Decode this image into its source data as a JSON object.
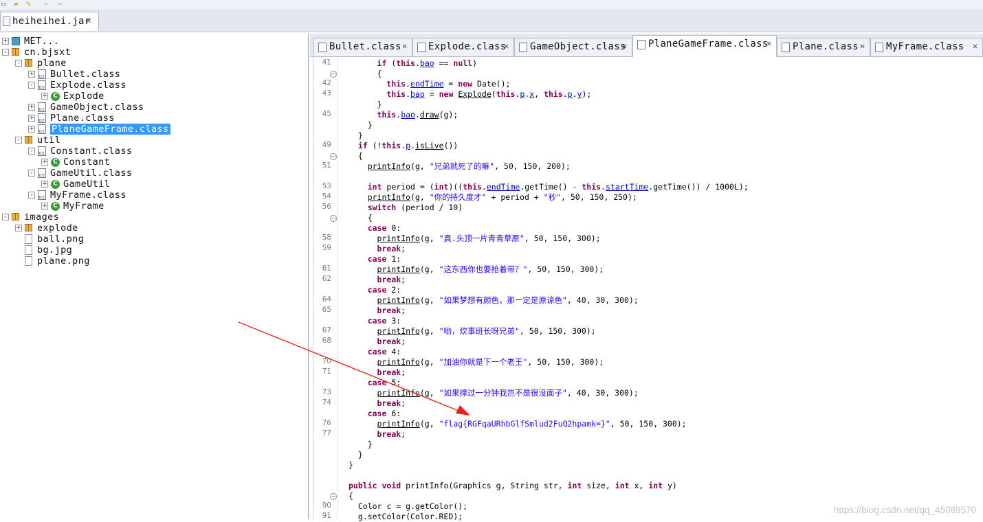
{
  "file_tab": {
    "label": "heiheihei.jar"
  },
  "tree": [
    {
      "label": "MET...",
      "kind": "meta",
      "indent": 0,
      "expander": "+"
    },
    {
      "label": "cn.bjsxt",
      "kind": "package",
      "indent": 0,
      "expander": "-"
    },
    {
      "label": "plane",
      "kind": "package",
      "indent": 1,
      "expander": "-"
    },
    {
      "label": "Bullet.class",
      "kind": "class",
      "indent": 2,
      "expander": "+"
    },
    {
      "label": "Explode.class",
      "kind": "class",
      "indent": 2,
      "expander": "-"
    },
    {
      "label": "Explode",
      "kind": "type",
      "indent": 3,
      "expander": "+"
    },
    {
      "label": "GameObject.class",
      "kind": "class",
      "indent": 2,
      "expander": "+"
    },
    {
      "label": "Plane.class",
      "kind": "class",
      "indent": 2,
      "expander": "+"
    },
    {
      "label": "PlaneGameFrame.class",
      "kind": "class",
      "indent": 2,
      "expander": "+",
      "selected": true
    },
    {
      "label": "util",
      "kind": "package",
      "indent": 1,
      "expander": "-"
    },
    {
      "label": "Constant.class",
      "kind": "class",
      "indent": 2,
      "expander": "-"
    },
    {
      "label": "Constant",
      "kind": "type",
      "indent": 3,
      "expander": "+"
    },
    {
      "label": "GameUtil.class",
      "kind": "class",
      "indent": 2,
      "expander": "-"
    },
    {
      "label": "GameUtil",
      "kind": "type",
      "indent": 3,
      "expander": "+"
    },
    {
      "label": "MyFrame.class",
      "kind": "class",
      "indent": 2,
      "expander": "-"
    },
    {
      "label": "MyFrame",
      "kind": "type",
      "indent": 3,
      "expander": "+"
    },
    {
      "label": "images",
      "kind": "package",
      "indent": 0,
      "expander": "-"
    },
    {
      "label": "explode",
      "kind": "package",
      "indent": 1,
      "expander": "+"
    },
    {
      "label": "ball.png",
      "kind": "file",
      "indent": 1,
      "expander": ""
    },
    {
      "label": "bg.jpg",
      "kind": "file",
      "indent": 1,
      "expander": ""
    },
    {
      "label": "plane.png",
      "kind": "file",
      "indent": 1,
      "expander": ""
    }
  ],
  "editor_tabs": [
    {
      "label": "Bullet.class",
      "active": false
    },
    {
      "label": "Explode.class",
      "active": false
    },
    {
      "label": "GameObject.class",
      "active": false
    },
    {
      "label": "PlaneGameFrame.class",
      "active": true
    },
    {
      "label": "Plane.class",
      "active": false
    },
    {
      "label": "MyFrame.class",
      "active": false
    }
  ],
  "code_lines": [
    {
      "n": "41",
      "fold": false,
      "html": "      <span class=\"kw\">if</span> (<span class=\"kw\">this</span>.<span class=\"fld u\">bao</span> == <span class=\"kw\">null</span>)"
    },
    {
      "n": "",
      "fold": true,
      "html": "      {"
    },
    {
      "n": "42",
      "fold": false,
      "html": "        <span class=\"kw\">this</span>.<span class=\"fld u\">endTime</span> = <span class=\"kw\">new</span> Date();"
    },
    {
      "n": "43",
      "fold": false,
      "html": "        <span class=\"kw\">this</span>.<span class=\"fld u\">bao</span> = <span class=\"kw\">new</span> <span class=\"u\">Explode</span>(<span class=\"kw\">this</span>.<span class=\"fld u\">p</span>.<span class=\"fld u\">x</span>, <span class=\"kw\">this</span>.<span class=\"fld u\">p</span>.<span class=\"fld u\">y</span>);"
    },
    {
      "n": "",
      "fold": false,
      "html": "      }"
    },
    {
      "n": "45",
      "fold": false,
      "html": "      <span class=\"kw\">this</span>.<span class=\"fld u\">bao</span>.<span class=\"u\">draw</span>(g);"
    },
    {
      "n": "",
      "fold": false,
      "html": "    }"
    },
    {
      "n": "",
      "fold": false,
      "html": "  }"
    },
    {
      "n": "49",
      "fold": false,
      "html": "  <span class=\"kw\">if</span> (!<span class=\"kw\">this</span>.<span class=\"fld u\">p</span>.<span class=\"u\">isLive</span>())"
    },
    {
      "n": "",
      "fold": true,
      "html": "  {"
    },
    {
      "n": "51",
      "fold": false,
      "html": "    <span class=\"u\">printInfo</span>(g, <span class=\"str\">\"兄弟就死了的嘛\"</span>, 50, 150, 200);"
    },
    {
      "n": "",
      "fold": false,
      "html": ""
    },
    {
      "n": "53",
      "fold": false,
      "html": "    <span class=\"kw\">int</span> period = (<span class=\"kw\">int</span>)((<span class=\"kw\">this</span>.<span class=\"fld u\">endTime</span>.getTime() - <span class=\"kw\">this</span>.<span class=\"fld u\">startTime</span>.getTime()) / 1000L);"
    },
    {
      "n": "54",
      "fold": false,
      "html": "    <span class=\"u\">printInfo</span>(g, <span class=\"str\">\"你的持久度才\"</span> + period + <span class=\"str\">\"秒\"</span>, 50, 150, 250);"
    },
    {
      "n": "56",
      "fold": false,
      "html": "    <span class=\"kw\">switch</span> (period / 10)"
    },
    {
      "n": "",
      "fold": true,
      "html": "    {"
    },
    {
      "n": "",
      "fold": false,
      "html": "    <span class=\"kw\">case</span> 0:"
    },
    {
      "n": "58",
      "fold": false,
      "html": "      <span class=\"u\">printInfo</span>(g, <span class=\"str\">\"真.头顶一片青青草原\"</span>, 50, 150, 300);"
    },
    {
      "n": "59",
      "fold": false,
      "html": "      <span class=\"kw\">break</span>;"
    },
    {
      "n": "",
      "fold": false,
      "html": "    <span class=\"kw\">case</span> 1:"
    },
    {
      "n": "61",
      "fold": false,
      "html": "      <span class=\"u\">printInfo</span>(g, <span class=\"str\">\"这东西你也要抢着带？\"</span>, 50, 150, 300);"
    },
    {
      "n": "62",
      "fold": false,
      "html": "      <span class=\"kw\">break</span>;"
    },
    {
      "n": "",
      "fold": false,
      "html": "    <span class=\"kw\">case</span> 2:"
    },
    {
      "n": "64",
      "fold": false,
      "html": "      <span class=\"u\">printInfo</span>(g, <span class=\"str\">\"如果梦想有颜色，那一定是原谅色\"</span>, 40, 30, 300);"
    },
    {
      "n": "65",
      "fold": false,
      "html": "      <span class=\"kw\">break</span>;"
    },
    {
      "n": "",
      "fold": false,
      "html": "    <span class=\"kw\">case</span> 3:"
    },
    {
      "n": "67",
      "fold": false,
      "html": "      <span class=\"u\">printInfo</span>(g, <span class=\"str\">\"哟，炊事班长呀兄弟\"</span>, 50, 150, 300);"
    },
    {
      "n": "68",
      "fold": false,
      "html": "      <span class=\"kw\">break</span>;"
    },
    {
      "n": "",
      "fold": false,
      "html": "    <span class=\"kw\">case</span> 4:"
    },
    {
      "n": "70",
      "fold": false,
      "html": "      <span class=\"u\">printInfo</span>(g, <span class=\"str\">\"加油你就是下一个老王\"</span>, 50, 150, 300);"
    },
    {
      "n": "71",
      "fold": false,
      "html": "      <span class=\"kw\">break</span>;"
    },
    {
      "n": "",
      "fold": false,
      "html": "    <span class=\"kw\">case</span> 5:"
    },
    {
      "n": "73",
      "fold": false,
      "html": "      <span class=\"u\">printInfo</span>(g, <span class=\"str\">\"如果撑过一分钟我岂不是很没面子\"</span>, 40, 30, 300);"
    },
    {
      "n": "74",
      "fold": false,
      "html": "      <span class=\"kw\">break</span>;"
    },
    {
      "n": "",
      "fold": false,
      "html": "    <span class=\"kw\">case</span> 6:"
    },
    {
      "n": "76",
      "fold": false,
      "html": "      <span class=\"u\">printInfo</span>(g, <span class=\"str\">\"flag{RGFqaURhbGlfSmlud2FuQ2hpamk=}\"</span>, 50, 150, 300);"
    },
    {
      "n": "77",
      "fold": false,
      "html": "      <span class=\"kw\">break</span>;"
    },
    {
      "n": "",
      "fold": false,
      "html": "    }"
    },
    {
      "n": "",
      "fold": false,
      "html": "  }"
    },
    {
      "n": "",
      "fold": false,
      "html": "}"
    },
    {
      "n": "",
      "fold": false,
      "html": ""
    },
    {
      "n": "",
      "fold": false,
      "html": "<span class=\"kw\">public</span> <span class=\"kw\">void</span> printInfo(Graphics g, String str, <span class=\"kw\">int</span> size, <span class=\"kw\">int</span> x, <span class=\"kw\">int</span> y)"
    },
    {
      "n": "",
      "fold": true,
      "html": "{"
    },
    {
      "n": "90",
      "fold": false,
      "html": "  Color c = g.getColor();"
    },
    {
      "n": "91",
      "fold": false,
      "html": "  g.setColor(Color.RED);"
    }
  ],
  "annotation": {
    "arrow_color": "#e8221b"
  },
  "watermark": "https://blog.csdn.net/qq_45089570"
}
